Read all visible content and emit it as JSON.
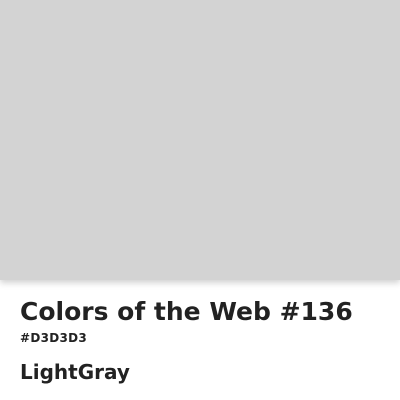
{
  "swatch": {
    "color": "#D3D3D3"
  },
  "card": {
    "title": "Colors of the Web #136",
    "hex_label": "#D3D3D3",
    "color_name": "LightGray"
  }
}
